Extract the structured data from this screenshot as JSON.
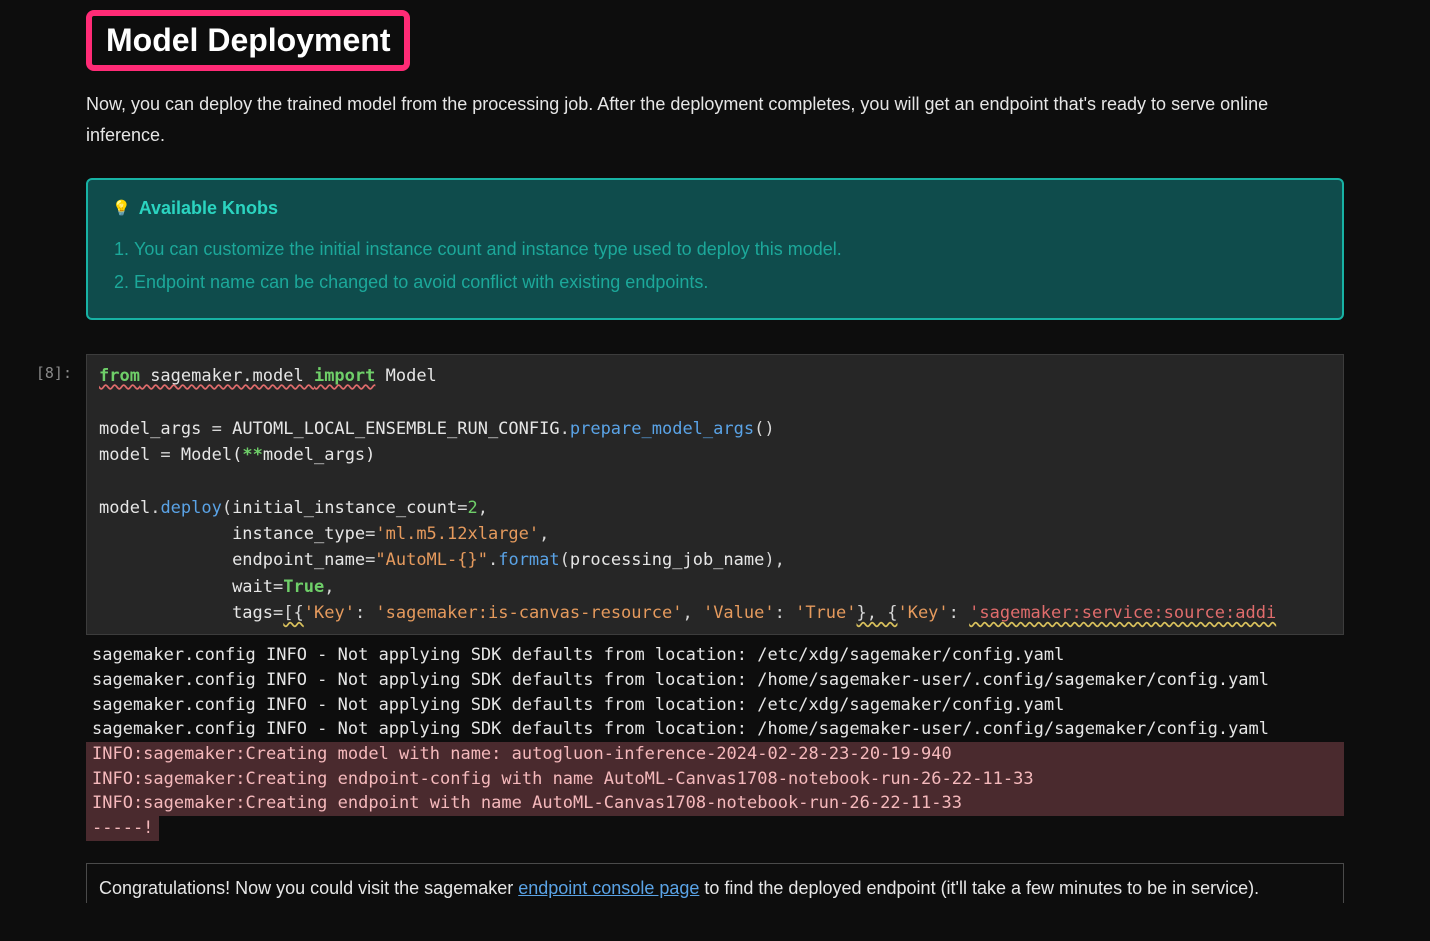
{
  "heading": "Model Deployment",
  "intro": "Now, you can deploy the trained model from the processing job. After the deployment completes, you will get an endpoint that's ready to serve online inference.",
  "callout": {
    "title": "Available Knobs",
    "items": [
      "You can customize the initial instance count and instance type used to deploy this model.",
      "Endpoint name can be changed to avoid conflict with existing endpoints."
    ]
  },
  "cell": {
    "prompt": "[8]:",
    "code": {
      "l1_from": "from",
      "l1_module": " sagemaker.model ",
      "l1_import": "import",
      "l1_name": " Model",
      "l3_a": "model_args ",
      "l3_eq": "=",
      "l3_b": " AUTOML_LOCAL_ENSEMBLE_RUN_CONFIG",
      "l3_dot": ".",
      "l3_fn": "prepare_model_args",
      "l3_par": "()",
      "l4_a": "model ",
      "l4_eq": "=",
      "l4_b": " Model(",
      "l4_kw": "**",
      "l4_c": "model_args)",
      "l6_a": "model",
      "l6_dot": ".",
      "l6_fn": "deploy",
      "l6_open": "(",
      "l6_p1": "initial_instance_count",
      "l6_eq1": "=",
      "l6_v1": "2",
      "l6_c1": ",",
      "l7_indent": "             ",
      "l7_p": "instance_type",
      "l7_eq": "=",
      "l7_v": "'ml.m5.12xlarge'",
      "l7_c": ",",
      "l8_p": "endpoint_name",
      "l8_eq": "=",
      "l8_v": "\"AutoML-{}\"",
      "l8_dot": ".",
      "l8_fn": "format",
      "l8_open": "(",
      "l8_arg": "processing_job_name",
      "l8_close": "),",
      "l9_p": "wait",
      "l9_eq": "=",
      "l9_v": "True",
      "l9_c": ",",
      "l10_p": "tags",
      "l10_eq": "=",
      "l10_open": "[{",
      "l10_k1lbl": "'Key'",
      "l10_colon": ": ",
      "l10_k1val": "'sagemaker:is-canvas-resource'",
      "l10_sep1": ", ",
      "l10_v1lbl": "'Value'",
      "l10_colon2": ": ",
      "l10_v1val": "'True'",
      "l10_close1": "}, {",
      "l10_k2lbl": "'Key'",
      "l10_colon3": ": ",
      "l10_k2val": "'sagemaker:service:source:addi"
    }
  },
  "output": {
    "plain": [
      "sagemaker.config INFO - Not applying SDK defaults from location: /etc/xdg/sagemaker/config.yaml",
      "sagemaker.config INFO - Not applying SDK defaults from location: /home/sagemaker-user/.config/sagemaker/config.yaml",
      "sagemaker.config INFO - Not applying SDK defaults from location: /etc/xdg/sagemaker/config.yaml",
      "sagemaker.config INFO - Not applying SDK defaults from location: /home/sagemaker-user/.config/sagemaker/config.yaml"
    ],
    "err": [
      "INFO:sagemaker:Creating model with name: autogluon-inference-2024-02-28-23-20-19-940",
      "INFO:sagemaker:Creating endpoint-config with name AutoML-Canvas1708-notebook-run-26-22-11-33",
      "INFO:sagemaker:Creating endpoint with name AutoML-Canvas1708-notebook-run-26-22-11-33"
    ],
    "tail": "-----!"
  },
  "congrats": {
    "before": "Congratulations! Now you could visit the sagemaker ",
    "link": "endpoint console page",
    "after": " to find the deployed endpoint (it'll take a few minutes to be in service)."
  }
}
